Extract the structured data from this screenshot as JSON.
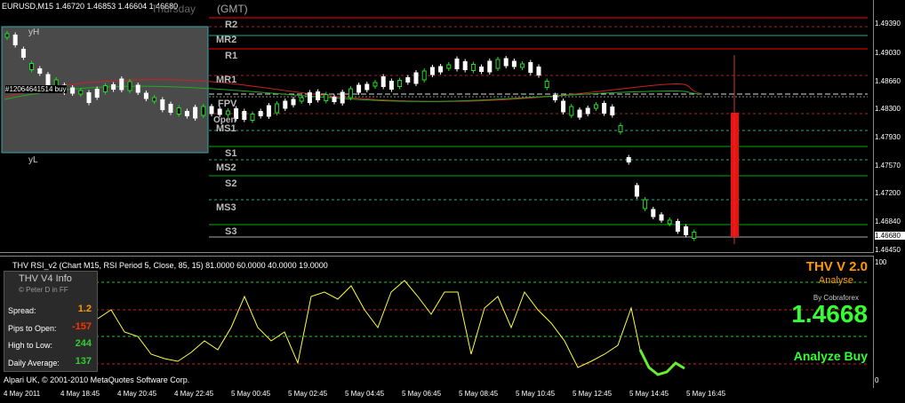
{
  "colors": {
    "background": "#000000",
    "candle_up": "#ffffff",
    "candle_down": "#00ff00",
    "resistance": "#ff0000",
    "support": "#00aa00",
    "rsi_line": "#ffff00",
    "accent_orange": "#ff9900",
    "accent_green": "#33ff33"
  },
  "header": {
    "symbol_info": "EURUSD,M15  1.46720 1.46853 1.46604 1.46680",
    "gmt_label": "(GMT)",
    "day_label": "Thursday"
  },
  "main_chart": {
    "yh_label": "yH",
    "yl_label": "yL",
    "order_label": "#12064641514 buy",
    "pivots": [
      {
        "label": "R2"
      },
      {
        "label": "MR2"
      },
      {
        "label": "R1"
      },
      {
        "label": "MR1"
      },
      {
        "label": "FPV"
      },
      {
        "label": "Open"
      },
      {
        "label": "MS1"
      },
      {
        "label": "S1"
      },
      {
        "label": "MS2"
      },
      {
        "label": "S2"
      },
      {
        "label": "MS3"
      },
      {
        "label": "S3"
      }
    ]
  },
  "price_scale": {
    "labels": [
      "1.49390",
      "1.49030",
      "1.48660",
      "1.48300",
      "1.47930",
      "1.47570",
      "1.47200",
      "1.46840",
      "1.46450"
    ],
    "current": "1.46680"
  },
  "rsi": {
    "title": "THV RSI_v2  (Chart M15, RSI Period 5,  Close,  85,  15)  81.0000 60.0000 40.0000 19.0000",
    "scale_top": "100",
    "scale_bottom": "0"
  },
  "info_box": {
    "title": "THV  V4  Info",
    "author": "© Peter D in FF",
    "rows": [
      {
        "label": "Spread:",
        "value": "1.2",
        "color": "#ff9900"
      },
      {
        "label": "Pips to Open:",
        "value": "-157",
        "color": "#ff3300"
      },
      {
        "label": "High to Low:",
        "value": "244",
        "color": "#33cc33"
      },
      {
        "label": "Daily Average:",
        "value": "137",
        "color": "#33cc33"
      }
    ]
  },
  "thv_panel": {
    "title": "THV V 2.0",
    "subtitle": "Analyse",
    "by": "By Cobraforex",
    "price": "1.4668",
    "signal": "Analyze Buy"
  },
  "footer": {
    "copyright": "Alpari UK, © 2001-2010 MetaQuotes Software Corp."
  },
  "time_axis": [
    "4 May 2011",
    "4 May 18:45",
    "4 May 20:45",
    "4 May 22:45",
    "5 May 00:45",
    "5 May 02:45",
    "5 May 04:45",
    "5 May 06:45",
    "5 May 08:45",
    "5 May 10:45",
    "5 May 12:45",
    "5 May 14:45",
    "5 May 16:45"
  ]
}
